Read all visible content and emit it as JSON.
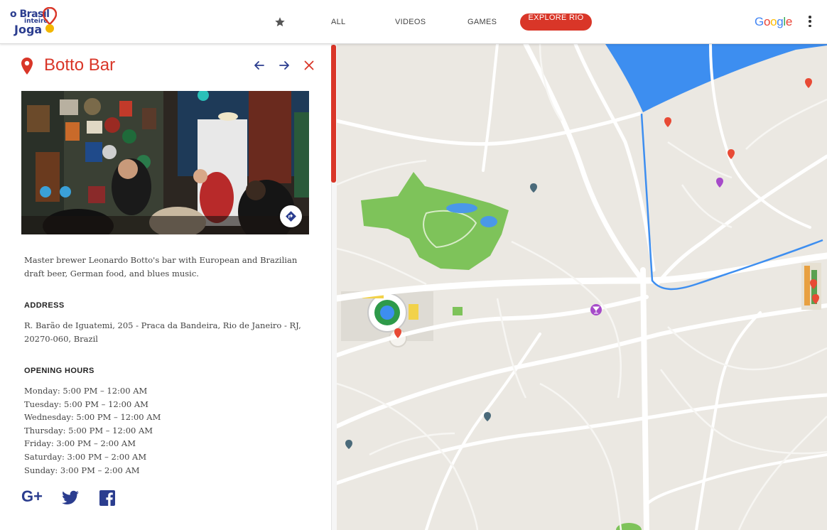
{
  "header": {
    "logo_text": "o Brasil inteiro Joga",
    "nav": {
      "all": "ALL",
      "videos": "VIDEOS",
      "games": "GAMES",
      "explore": "EXPLORE RIO"
    },
    "google_brand": "Google",
    "accent_color": "#d93628"
  },
  "place": {
    "title": "Botto Bar",
    "description": "Master brewer Leonardo Botto's bar with European and Brazilian draft beer, German food, and blues music.",
    "address_label": "ADDRESS",
    "address": "R. Barão de Iguatemi, 205 - Praca da Bandeira, Rio de Janeiro - RJ, 20270-060, Brazil",
    "hours_label": "OPENING HOURS",
    "hours": [
      "Monday: 5:00 PM – 12:00 AM",
      "Tuesday: 5:00 PM – 12:00 AM",
      "Wednesday: 5:00 PM – 12:00 AM",
      "Thursday: 5:00 PM – 12:00 AM",
      "Friday: 3:00 PM – 2:00 AM",
      "Saturday: 3:00 PM – 2:00 AM",
      "Sunday: 3:00 PM – 2:00 AM"
    ]
  },
  "social": {
    "gplus_label": "G+"
  },
  "icons": [
    "star-icon",
    "kebab-menu-icon",
    "location-pin-icon",
    "arrow-left-icon",
    "arrow-right-icon",
    "close-icon",
    "directions-icon",
    "google-plus-icon",
    "twitter-icon",
    "facebook-icon"
  ]
}
